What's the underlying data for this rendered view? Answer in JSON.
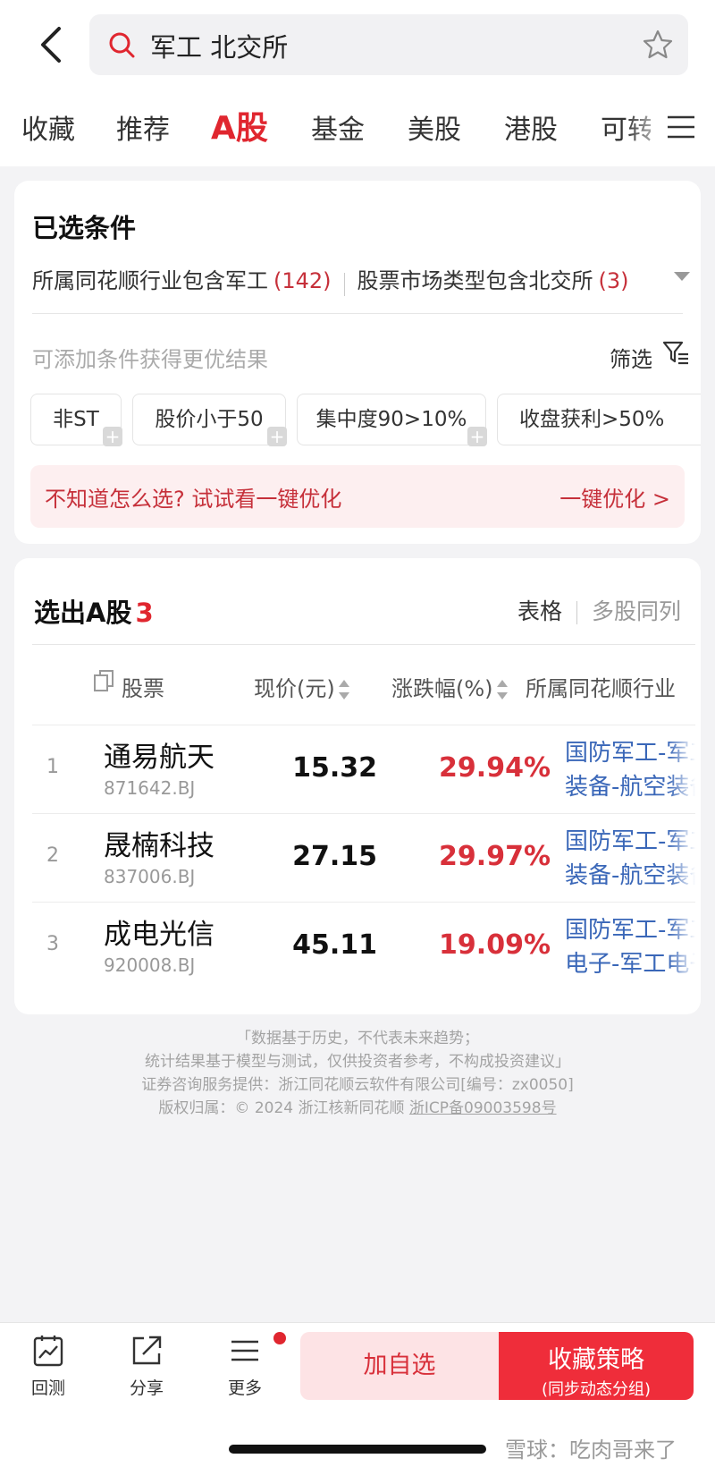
{
  "search": {
    "query": "军工 北交所"
  },
  "tabs": [
    "收藏",
    "推荐",
    "A股",
    "基金",
    "美股",
    "港股",
    "可转债"
  ],
  "active_tab": "A股",
  "conditions": {
    "title": "已选条件",
    "items": [
      {
        "label": "所属同花顺行业包含军工",
        "count": "(142)"
      },
      {
        "label": "股票市场类型包含北交所",
        "count": "(3)"
      }
    ],
    "hint": "可添加条件获得更优结果",
    "filter_label": "筛选",
    "chips": [
      "非ST",
      "股价小于50",
      "集中度90>10%",
      "收盘获利>50%"
    ],
    "optimize_text": "不知道怎么选? 试试看一键优化",
    "optimize_button": "一键优化 >"
  },
  "results": {
    "title_prefix": "选出A股",
    "count": "3",
    "view_table": "表格",
    "view_multi": "多股同列",
    "columns": {
      "stock": "股票",
      "price": "现价(元)",
      "change": "涨跌幅(%)",
      "industry": "所属同花顺行业"
    },
    "rows": [
      {
        "index": "1",
        "name": "通易航天",
        "code": "871642.BJ",
        "price": "15.32",
        "change": "29.94%",
        "industry_line1": "国防军工-军工",
        "industry_line2": "装备-航空装备"
      },
      {
        "index": "2",
        "name": "晟楠科技",
        "code": "837006.BJ",
        "price": "27.15",
        "change": "29.97%",
        "industry_line1": "国防军工-军工",
        "industry_line2": "装备-航空装备"
      },
      {
        "index": "3",
        "name": "成电光信",
        "code": "920008.BJ",
        "price": "45.11",
        "change": "19.09%",
        "industry_line1": "国防军工-军工",
        "industry_line2": "电子-军工电子"
      }
    ]
  },
  "disclaimer": {
    "line1": "「数据基于历史，不代表未来趋势；",
    "line2": "统计结果基于模型与测试，仅供投资者参考，不构成投资建议」",
    "line3": "证券咨询服务提供：浙江同花顺云软件有限公司[编号：zx0050]",
    "line4_prefix": "版权归属：© 2024 浙江核新同花顺 ",
    "line4_icp": "浙ICP备09003598号"
  },
  "bottom_bar": {
    "backtest": "回测",
    "share": "分享",
    "more": "更多",
    "add_watch": "加自选",
    "save_strategy": "收藏策略",
    "save_strategy_sub": "(同步动态分组)"
  },
  "watermark": "雪球：吃肉哥来了",
  "colors": {
    "accent": "#e0262f",
    "link": "#3a67b8",
    "gain": "#d8303a"
  }
}
